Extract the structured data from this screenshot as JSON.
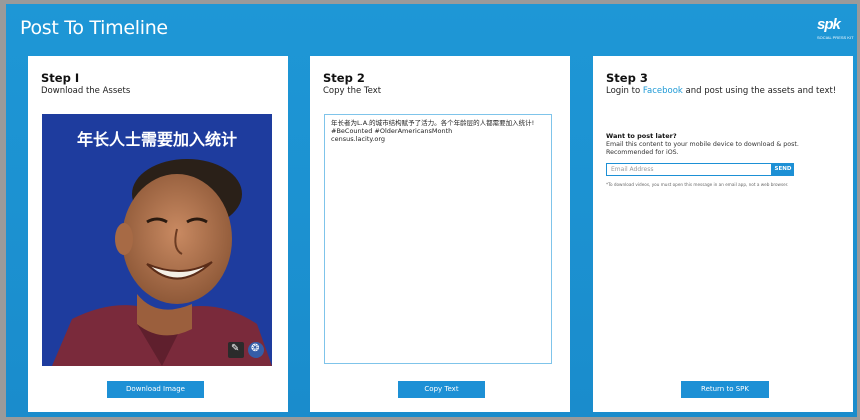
{
  "header": {
    "title": "Post To Timeline",
    "logo_text": "spk",
    "logo_subtext": "SOCIAL PRESS KIT"
  },
  "step1": {
    "title": "Step I",
    "subtitle": "Download the Assets",
    "poster_headline": "年长人士需要加入统计",
    "button_label": "Download Image"
  },
  "step2": {
    "title": "Step 2",
    "subtitle": "Copy the Text",
    "text_lines": [
      "年长者为L.A.的城市结构赋予了活力。各个年龄层的人都需要加入统计!",
      "#BeCounted #OlderAmericansMonth",
      "census.lacity.org"
    ],
    "button_label": "Copy Text"
  },
  "step3": {
    "title": "Step 3",
    "subtitle_pre": "Login to ",
    "subtitle_link": "Facebook",
    "subtitle_post": " and post using the assets and text!",
    "later_title": "Want to post later?",
    "later_desc": "Email this content to your mobile device to download & post. Recommended for iOS.",
    "email_placeholder": "Email Address",
    "send_label": "SEND",
    "fine_print": "*To download videos, you must open this message in an email app, not a web browser.",
    "button_label": "Return to SPK"
  },
  "colors": {
    "background": "#1e97d6",
    "accent": "#1d90d5",
    "link": "#1f9ad6",
    "poster_bg": "#1e3c9e"
  },
  "icons": [
    "spk-logo-icon",
    "pen-icon",
    "seal-icon"
  ]
}
